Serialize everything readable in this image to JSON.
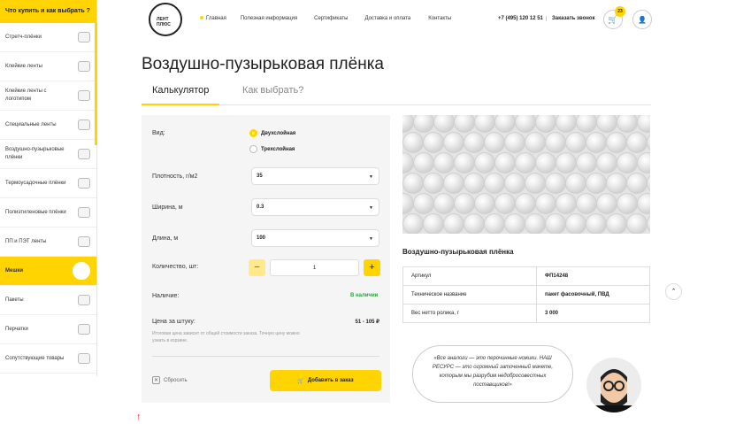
{
  "sidebar": {
    "header": "Что купить и как выбрать ?",
    "items": [
      {
        "label": "Стретч-плёнки",
        "icon": "stretch-film-icon"
      },
      {
        "label": "Клейкие ленты",
        "icon": "tape-icon"
      },
      {
        "label": "Клейкие ленты с логотипом",
        "icon": "logo-tape-icon"
      },
      {
        "label": "Специальные ленты",
        "icon": "special-tape-icon"
      },
      {
        "label": "Воздушно-пузырьковые плёнки",
        "icon": "bubble-wrap-icon"
      },
      {
        "label": "Термоусадочные плёнки",
        "icon": "shrink-film-icon"
      },
      {
        "label": "Полиэтиленовые плёнки",
        "icon": "pe-film-icon"
      },
      {
        "label": "ПП и ПЭТ ленты",
        "icon": "strap-icon"
      },
      {
        "label": "Мешки",
        "icon": "bag-icon",
        "active": true
      },
      {
        "label": "Пакеты",
        "icon": "packet-icon"
      },
      {
        "label": "Перчатки",
        "icon": "gloves-icon"
      },
      {
        "label": "Сопутствующие товары",
        "icon": "tools-icon"
      }
    ]
  },
  "header": {
    "logo_text": "ЛЕНТ ПЛЮС",
    "nav": [
      "Главная",
      "Полезная информация",
      "Сертификаты",
      "Доставка и оплата",
      "Контакты"
    ],
    "phone": "+7 (495) 120 12 51",
    "callback": "Заказать звонок",
    "cart_count": "23"
  },
  "page": {
    "title": "Воздушно-пузырьковая плёнка",
    "tabs": [
      "Калькулятор",
      "Как выбрать?"
    ]
  },
  "calculator": {
    "type_label": "Вид:",
    "options": [
      "Двухслойная",
      "Трехслойная"
    ],
    "density_label": "Плотность,  г/м2",
    "density_value": "35",
    "width_label": "Ширина, м",
    "width_value": "0.3",
    "length_label": "Длина, м",
    "length_value": "100",
    "qty_label": "Количество, шт:",
    "qty_value": "1",
    "qty_minus": "−",
    "qty_plus": "+",
    "availability_label": "Наличие:",
    "availability_value": "В наличии",
    "price_label": "Цена за штуку:",
    "price_value": "51 - 105 ₽",
    "note": "Итоговая цена зависит от общей стоимости заказа. Точную цену можно узнать в корзине.",
    "reset": "Сбросить",
    "add_to_order": "Добавить в заказ"
  },
  "product": {
    "title": "Воздушно-пузырьковая плёнка",
    "specs": [
      {
        "key": "Артикул",
        "value": "ФП14248"
      },
      {
        "key": "Техническое название",
        "value": "пакет фасовочный, ПВД"
      },
      {
        "key": "Вес нетто ролика, г",
        "value": "3 000"
      }
    ],
    "quote": "«Все аналоги — это перочинные ножики. НАШ РЕСУРС — это огромный заточенный мачете, которым мы разрубим недобросовестных поставщиков!»"
  },
  "colors": {
    "accent": "#ffd400",
    "available": "#2ba33f",
    "arrow": "#ee3333"
  }
}
